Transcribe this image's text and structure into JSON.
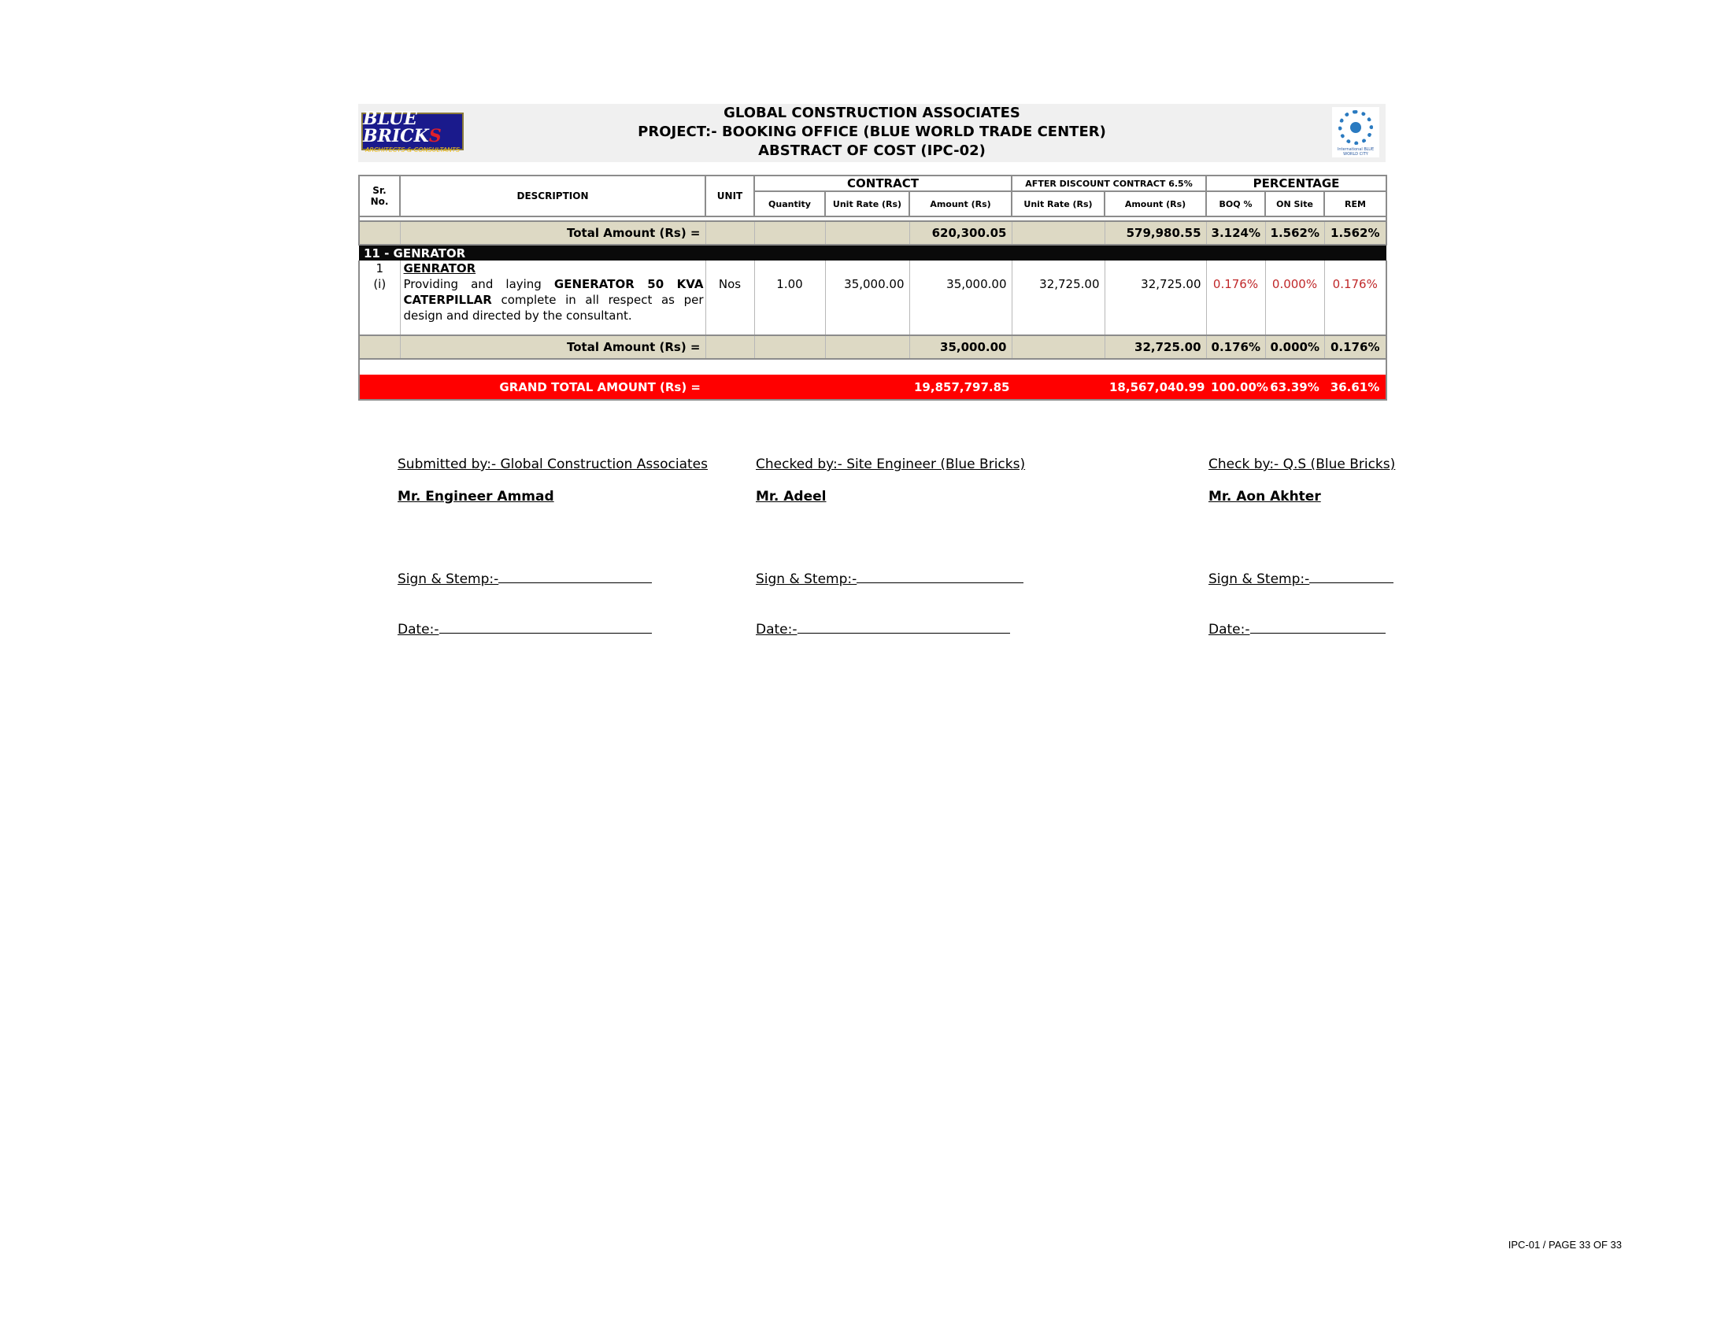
{
  "header": {
    "company": "GLOBAL CONSTRUCTION ASSOCIATES",
    "project": "PROJECT:- BOOKING OFFICE (BLUE WORLD TRADE CENTER)",
    "abstract": "ABSTRACT OF COST (IPC-02)",
    "logo_left": {
      "main": "BLUE BRICK",
      "main_accent": "S",
      "sub": "ARCHITECTS & CONSULTANTS"
    },
    "logo_right": {
      "caption": "International BLUE WORLD CITY"
    }
  },
  "table": {
    "headers": {
      "sr": "Sr. No.",
      "description": "DESCRIPTION",
      "unit": "UNIT",
      "contract": "CONTRACT",
      "after_discount": "AFTER DISCOUNT CONTRACT 6.5%",
      "percentage": "PERCENTAGE",
      "quantity": "Quantity",
      "unit_rate": "Unit Rate (Rs)",
      "amount": "Amount (Rs)",
      "ad_unit_rate": "Unit Rate (Rs)",
      "ad_amount": "Amount (Rs)",
      "boq": "BOQ %",
      "on_site": "ON Site",
      "rem": "REM"
    },
    "top_total": {
      "label": "Total Amount (Rs) =",
      "amount": "620,300.05",
      "ad_amount": "579,980.55",
      "boq": "3.124%",
      "on_site": "1.562%",
      "rem": "1.562%"
    },
    "section": "11 - GENRATOR",
    "item": {
      "sr": "1",
      "sub_sr": "(i)",
      "heading": "GENRATOR",
      "desc_pre": "Providing and laying ",
      "desc_bold1": "GENERATOR 50 KVA",
      "desc_bold2": "CATERPILLAR",
      "desc_post": " complete in all respect as per design and directed by the consultant.",
      "unit": "Nos",
      "quantity": "1.00",
      "unit_rate": "35,000.00",
      "amount": "35,000.00",
      "ad_unit_rate": "32,725.00",
      "ad_amount": "32,725.00",
      "boq": "0.176%",
      "on_site": "0.000%",
      "rem": "0.176%"
    },
    "item_total": {
      "label": "Total Amount (Rs) =",
      "amount": "35,000.00",
      "ad_amount": "32,725.00",
      "boq": "0.176%",
      "on_site": "0.000%",
      "rem": "0.176%"
    },
    "grand_total": {
      "label": "GRAND TOTAL AMOUNT (Rs) =",
      "amount": "19,857,797.85",
      "ad_amount": "18,567,040.99",
      "boq": "100.00%",
      "on_site": "63.39%",
      "rem": "36.61%"
    }
  },
  "signatures": {
    "submitted_by": "Submitted by:- Global Construction Associates",
    "checked_by": "Checked by:- Site Engineer (Blue Bricks)",
    "check_by": "Check by:- Q.S (Blue Bricks)",
    "name1": "Mr. Engineer Ammad",
    "name2": "Mr. Adeel",
    "name3": "Mr. Aon Akhter",
    "sign_label": "Sign & Stemp:-",
    "date_label": "Date:-"
  },
  "footer": "IPC-01 / PAGE 33 OF 33",
  "colors": {
    "grand_total_bg": "#ff0000",
    "total_bg": "#ddd9c4",
    "percent_red": "#c0282a",
    "section_bg": "#0a0a0a"
  }
}
